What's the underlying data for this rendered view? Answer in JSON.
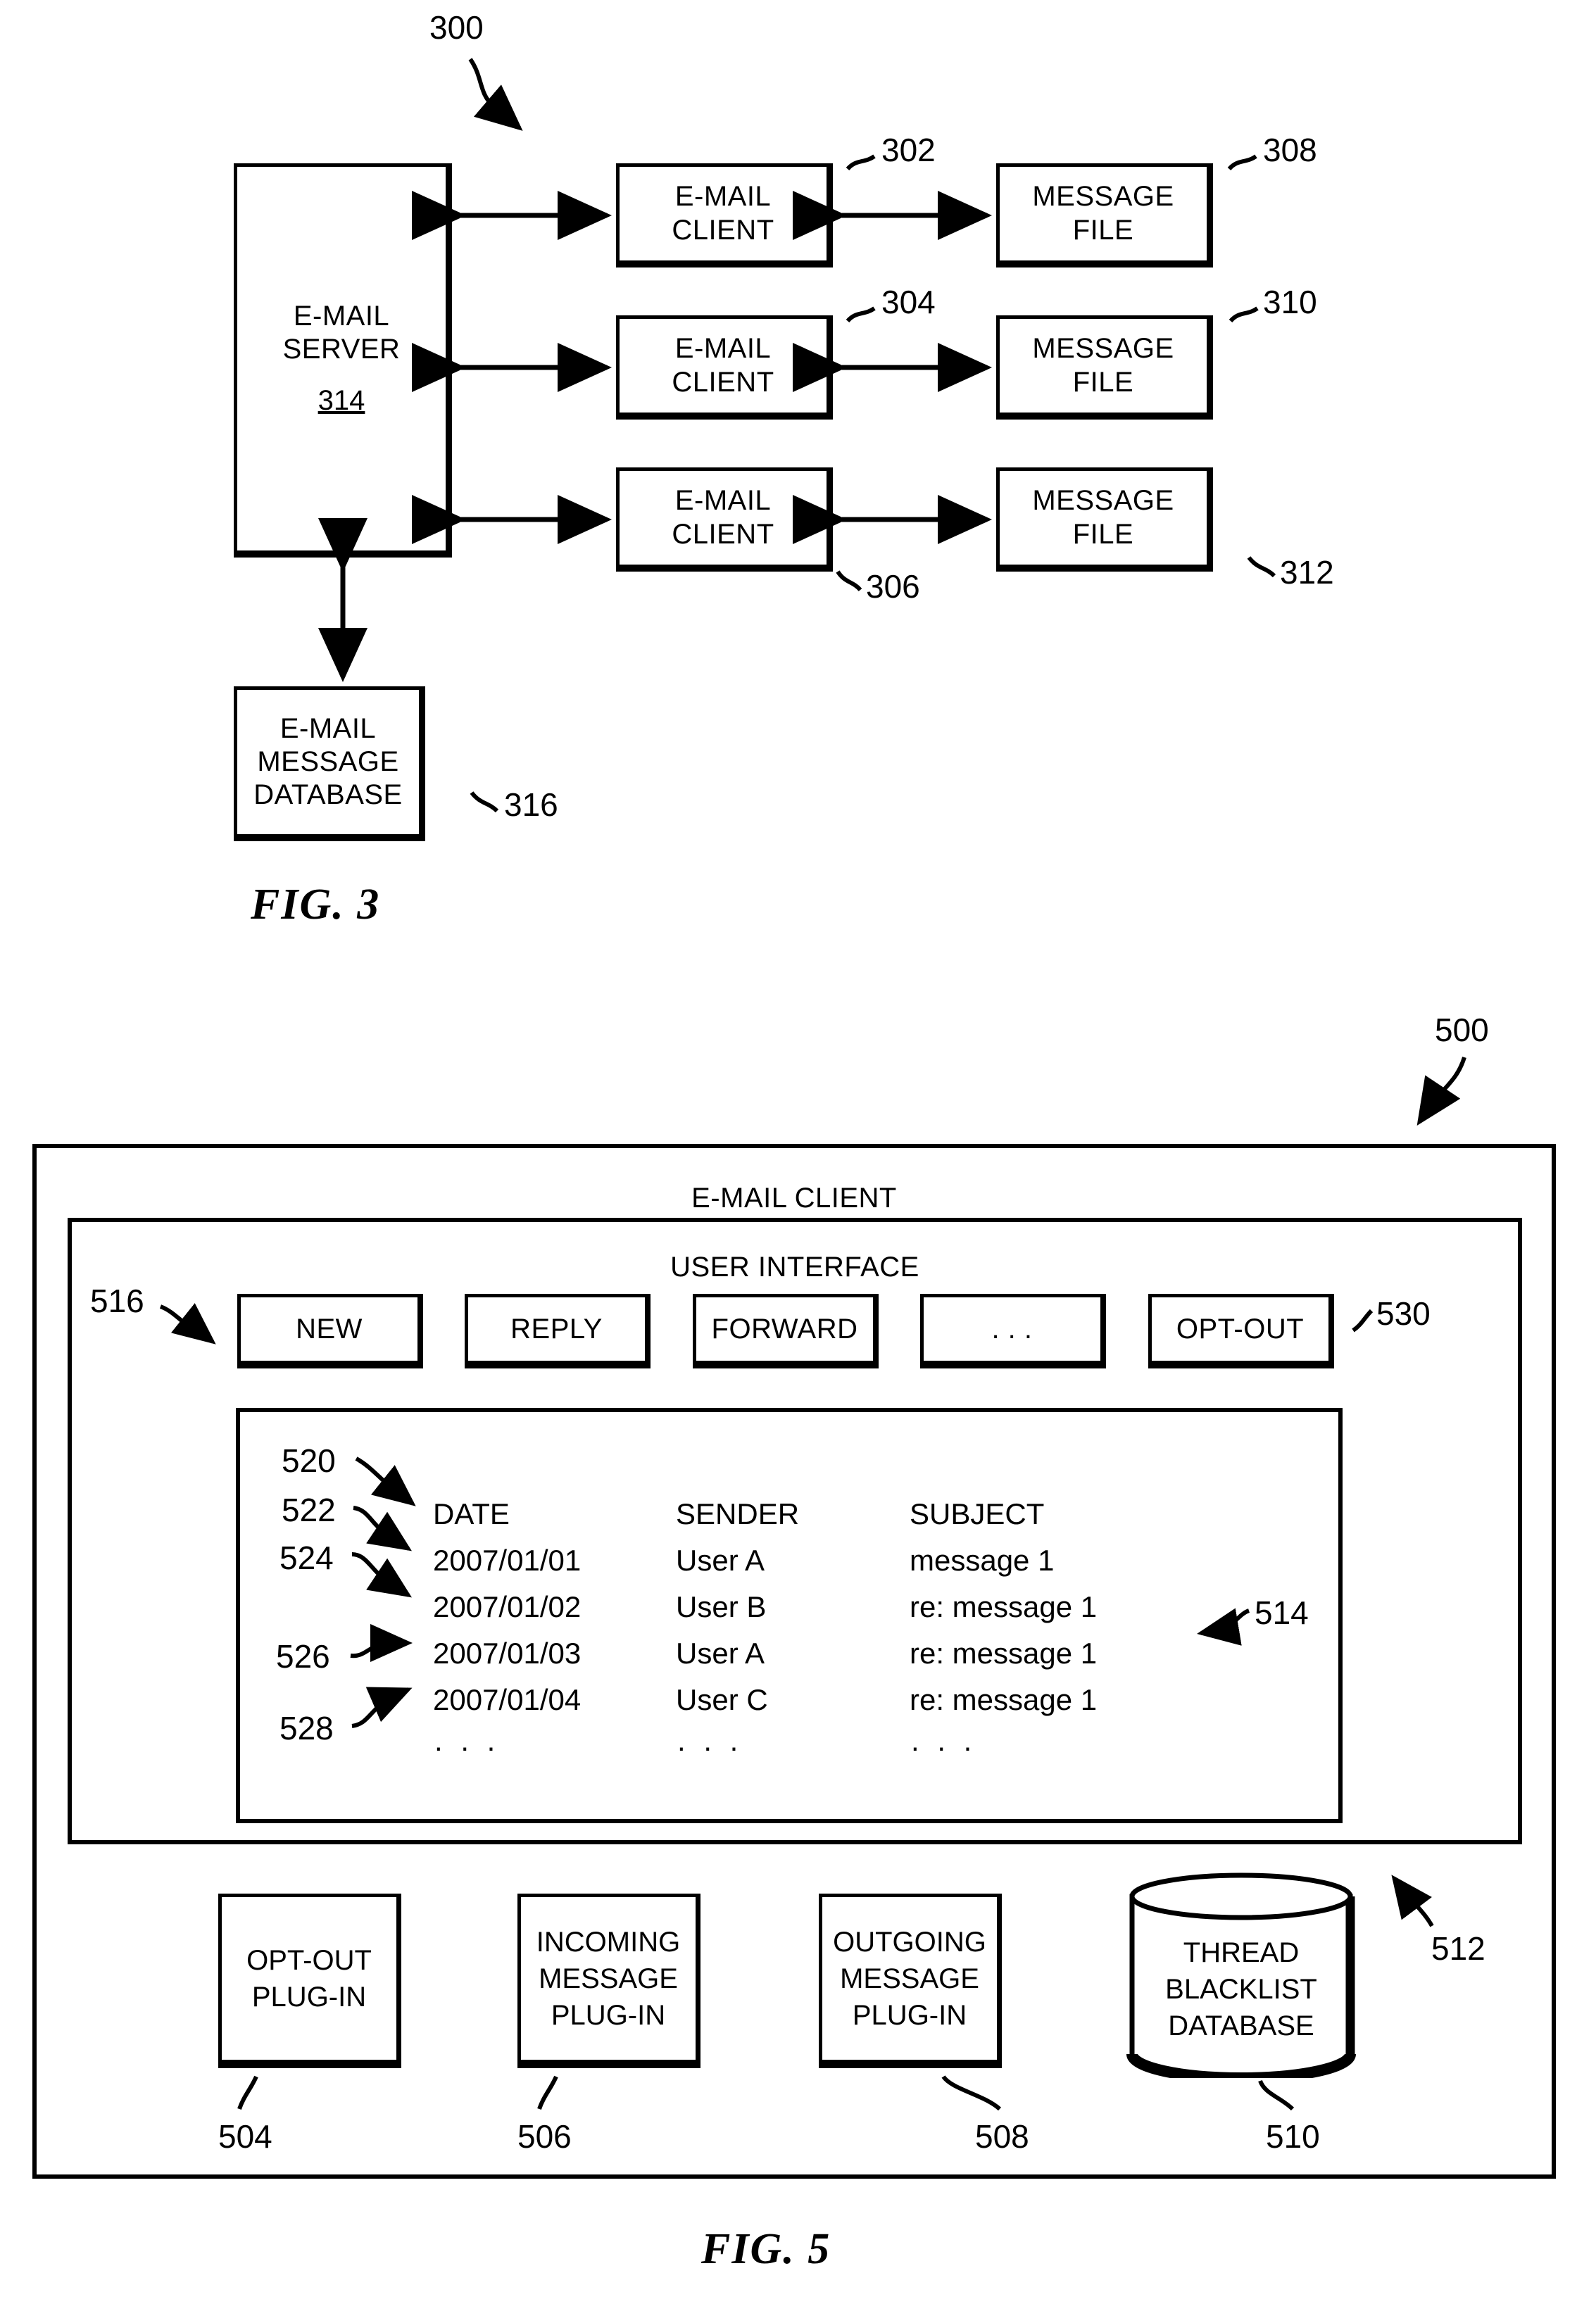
{
  "figures": [
    {
      "caption": "FIG. 3",
      "ref": "300",
      "nodes": {
        "server": {
          "line1": "E-MAIL",
          "line2": "SERVER",
          "num": "314"
        },
        "clients": [
          {
            "line1": "E-MAIL",
            "line2": "CLIENT",
            "ref": "302"
          },
          {
            "line1": "E-MAIL",
            "line2": "CLIENT",
            "ref": "304"
          },
          {
            "line1": "E-MAIL",
            "line2": "CLIENT",
            "ref": "306"
          }
        ],
        "message_files": [
          {
            "line1": "MESSAGE",
            "line2": "FILE",
            "ref": "308"
          },
          {
            "line1": "MESSAGE",
            "line2": "FILE",
            "ref": "310"
          },
          {
            "line1": "MESSAGE",
            "line2": "FILE",
            "ref": "312"
          }
        ],
        "database": {
          "line1": "E-MAIL",
          "line2": "MESSAGE",
          "line3": "DATABASE",
          "ref": "316"
        }
      }
    },
    {
      "caption": "FIG. 5",
      "ref": "500",
      "client_title": "E-MAIL CLIENT",
      "ui_title": "USER INTERFACE",
      "ui_ref": "516",
      "client_inner_ref": "512",
      "toolbar": {
        "buttons": [
          {
            "label": "NEW"
          },
          {
            "label": "REPLY"
          },
          {
            "label": "FORWARD"
          },
          {
            "label": ". . ."
          },
          {
            "label": "OPT-OUT",
            "ref": "530"
          }
        ]
      },
      "message_list": {
        "ref": "514",
        "header_ref": "520",
        "columns": [
          "DATE",
          "SENDER",
          "SUBJECT"
        ],
        "rows": [
          {
            "ref": "522",
            "date": "2007/01/01",
            "sender": "User A",
            "subject": "message 1"
          },
          {
            "ref": "524",
            "date": "2007/01/02",
            "sender": "User B",
            "subject": "re: message 1"
          },
          {
            "ref": "526",
            "date": "2007/01/03",
            "sender": "User A",
            "subject": "re: message 1"
          },
          {
            "ref": "528",
            "date": "2007/01/04",
            "sender": "User C",
            "subject": "re: message 1"
          }
        ],
        "continuation": ". . ."
      },
      "plugins": [
        {
          "line1": "OPT-OUT",
          "line2": "PLUG-IN",
          "line3": "",
          "ref": "504"
        },
        {
          "line1": "INCOMING",
          "line2": "MESSAGE",
          "line3": "PLUG-IN",
          "ref": "506"
        },
        {
          "line1": "OUTGOING",
          "line2": "MESSAGE",
          "line3": "PLUG-IN",
          "ref": "508"
        }
      ],
      "blacklist_db": {
        "line1": "THREAD",
        "line2": "BLACKLIST",
        "line3": "DATABASE",
        "ref": "510"
      }
    }
  ]
}
